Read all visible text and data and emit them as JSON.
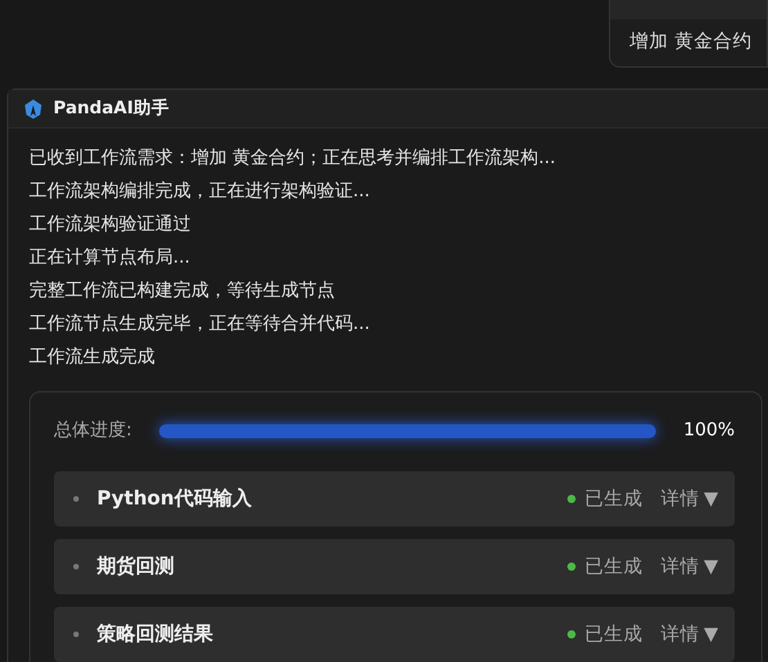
{
  "user_message": {
    "text": "增加 黄金合约"
  },
  "assistant": {
    "name": "PandaAI助手",
    "log": [
      "已收到工作流需求：增加 黄金合约；正在思考并编排工作流架构...",
      "工作流架构编排完成，正在进行架构验证...",
      "工作流架构验证通过",
      "正在计算节点布局...",
      "完整工作流已构建完成，等待生成节点",
      "工作流节点生成完毕，正在等待合并代码...",
      "工作流生成完成"
    ],
    "progress": {
      "label": "总体进度:",
      "level": 1,
      "reading": "100%"
    },
    "nodes": [
      {
        "name": "Python代码输入",
        "status": "已生成",
        "details": "详情",
        "caret": "▼"
      },
      {
        "name": "期货回测",
        "status": "已生成",
        "details": "详情",
        "caret": "▼"
      },
      {
        "name": "策略回测结果",
        "status": "已生成",
        "details": "详情",
        "caret": "▼"
      }
    ]
  }
}
